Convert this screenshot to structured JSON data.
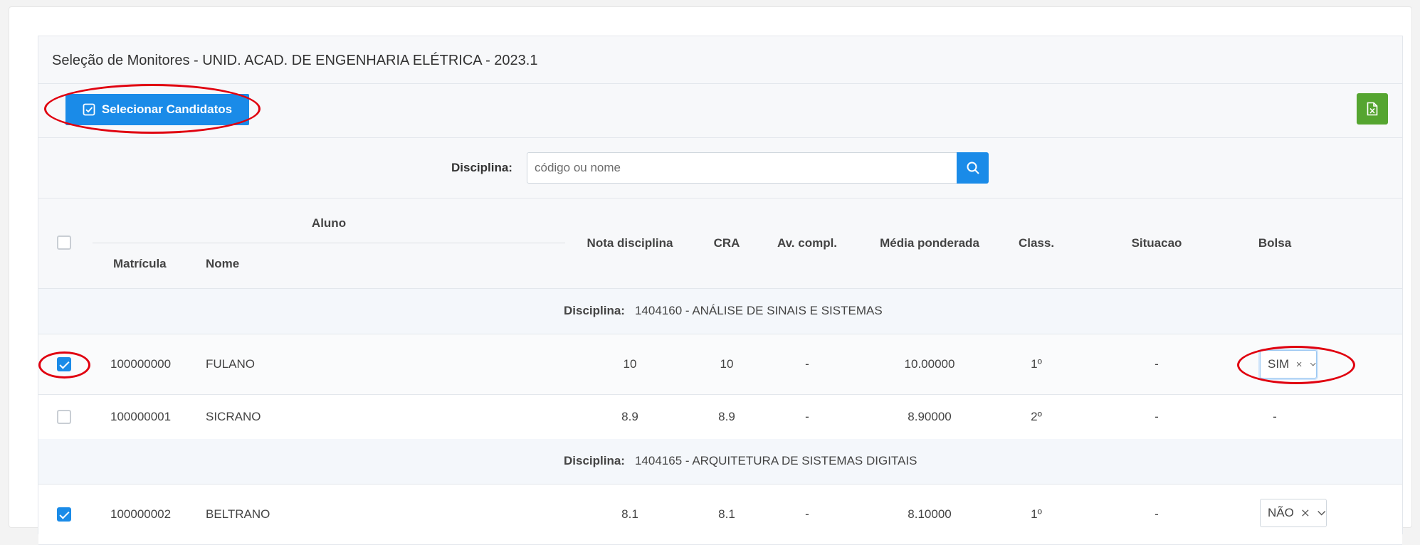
{
  "header": {
    "title": "Seleção de Monitores - UNID. ACAD. DE ENGENHARIA ELÉTRICA - 2023.1"
  },
  "toolbar": {
    "select_label": "Selecionar Candidatos",
    "export_icon": "excel-file-icon"
  },
  "filter": {
    "label": "Disciplina:",
    "placeholder": "código ou nome",
    "value": ""
  },
  "table": {
    "headers": {
      "aluno": "Aluno",
      "matricula": "Matrícula",
      "nome": "Nome",
      "nota": "Nota disciplina",
      "cra": "CRA",
      "av": "Av. compl.",
      "media": "Média ponderada",
      "class": "Class.",
      "situacao": "Situacao",
      "bolsa": "Bolsa"
    },
    "groups": [
      {
        "label": "Disciplina:",
        "name": "1404160 - ANÁLISE DE SINAIS E SISTEMAS",
        "rows": [
          {
            "checked": true,
            "matricula": "100000000",
            "nome": "FULANO",
            "nota": "10",
            "cra": "10",
            "av": "-",
            "media": "10.00000",
            "class": "1º",
            "situacao": "-",
            "bolsa": "SIM"
          },
          {
            "checked": false,
            "matricula": "100000001",
            "nome": "SICRANO",
            "nota": "8.9",
            "cra": "8.9",
            "av": "-",
            "media": "8.90000",
            "class": "2º",
            "situacao": "-",
            "bolsa": "-"
          }
        ]
      },
      {
        "label": "Disciplina:",
        "name": "1404165 - ARQUITETURA DE SISTEMAS DIGITAIS",
        "rows": [
          {
            "checked": true,
            "matricula": "100000002",
            "nome": "BELTRANO",
            "nota": "8.1",
            "cra": "8.1",
            "av": "-",
            "media": "8.10000",
            "class": "1º",
            "situacao": "-",
            "bolsa": "NÃO"
          }
        ]
      }
    ]
  },
  "colors": {
    "primary": "#1a8be8",
    "excel": "#55a530",
    "highlight": "#e0000f"
  }
}
